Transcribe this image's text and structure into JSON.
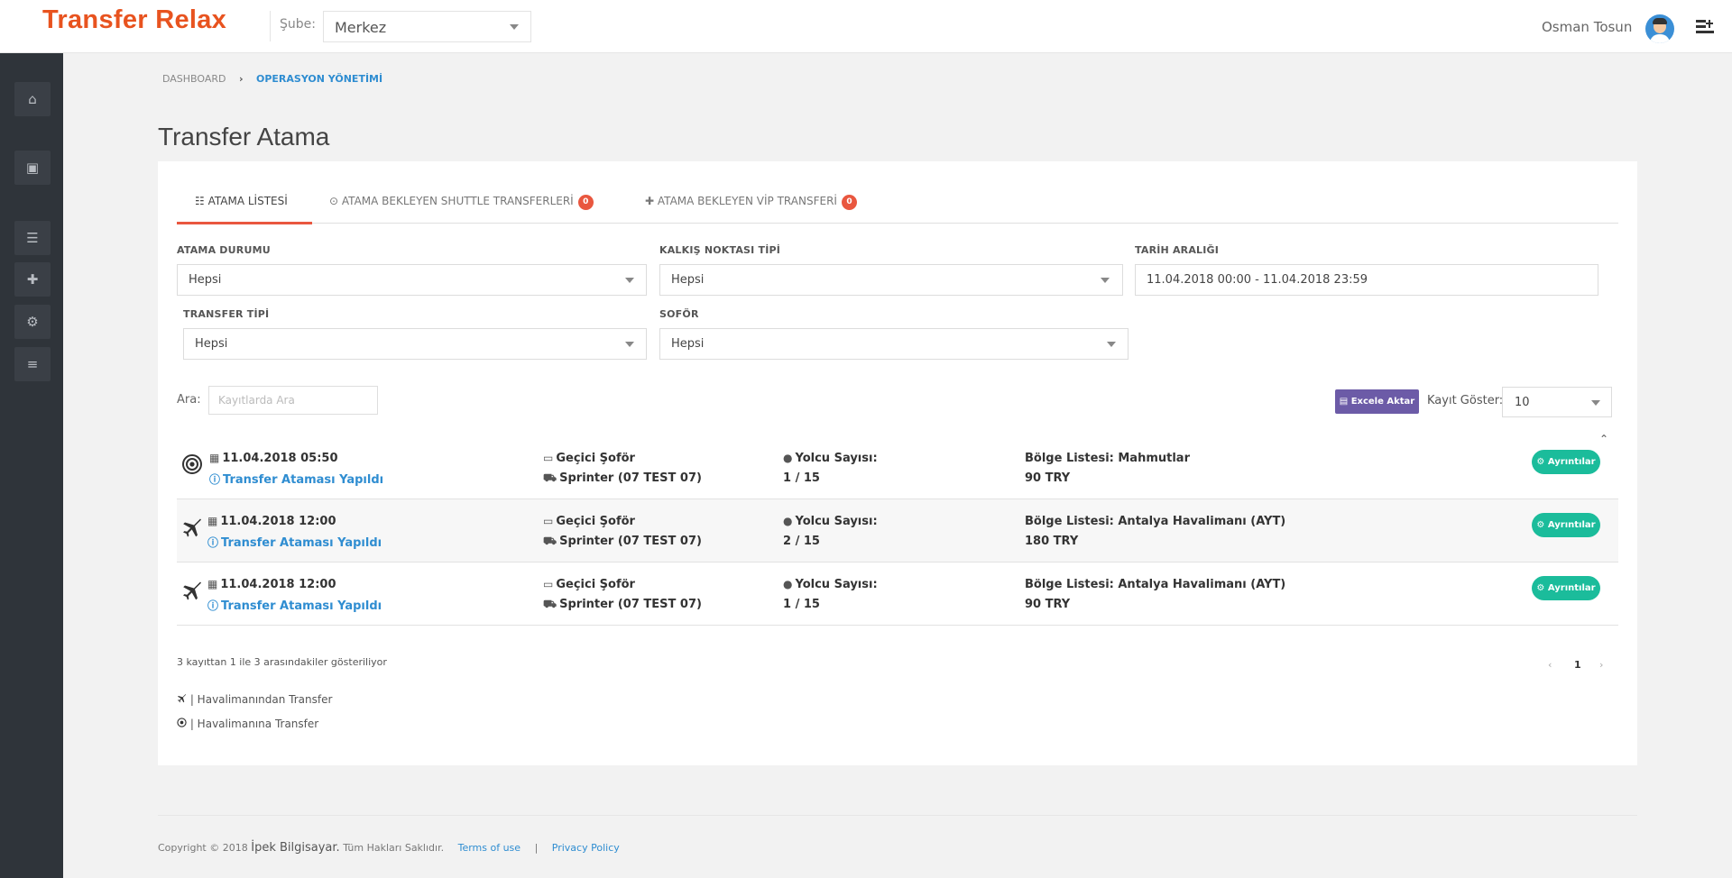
{
  "header": {
    "logo": "Transfer Relax",
    "branch_label": "Şube:",
    "branch_value": "Merkez",
    "user_name": "Osman Tosun"
  },
  "sidebar": {
    "items": [
      {
        "icon": "home-icon",
        "glyph": "⌂"
      },
      {
        "icon": "bus-icon",
        "glyph": "▣"
      },
      {
        "icon": "list-icon",
        "glyph": "☰"
      },
      {
        "icon": "plus-icon",
        "glyph": "✚"
      },
      {
        "icon": "gear-icon",
        "glyph": "⚙"
      },
      {
        "icon": "menu-icon",
        "glyph": "≡"
      }
    ]
  },
  "breadcrumb": {
    "root": "DASHBOARD",
    "separator": "›",
    "current": "OPERASYON YÖNETİMİ"
  },
  "page": {
    "title": "Transfer Atama"
  },
  "tabs": [
    {
      "icon": "list-icon",
      "glyph": "☷",
      "label": "ATAMA LİSTESİ",
      "badge": ""
    },
    {
      "icon": "clock-icon",
      "glyph": "⊙",
      "label": "ATAMA BEKLEYEN SHUTTLE TRANSFERLERİ",
      "badge": "0"
    },
    {
      "icon": "plus-icon",
      "glyph": "✚",
      "label": "ATAMA BEKLEYEN VİP TRANSFERİ",
      "badge": "0"
    }
  ],
  "filters": {
    "atama_durumu": {
      "label": "ATAMA DURUMU",
      "value": "Hepsi"
    },
    "kalkis_noktasi": {
      "label": "KALKIŞ NOKTASI TİPİ",
      "value": "Hepsi"
    },
    "tarih_araligi": {
      "label": "TARİH ARALIĞI",
      "value": "11.04.2018 00:00 - 11.04.2018 23:59"
    },
    "transfer_tipi": {
      "label": "TRANSFER TİPİ",
      "value": "Hepsi"
    },
    "sofor": {
      "label": "SOFÖR",
      "value": "Hepsi"
    }
  },
  "toolbar": {
    "search_label": "Ara:",
    "search_placeholder": "Kayıtlarda Ara",
    "excel_label": "Excele Aktar",
    "show_label": "Kayıt Göster:",
    "show_value": "10"
  },
  "rows": [
    {
      "type": "to-airport",
      "datetime": "11.04.2018 05:50",
      "status": "Transfer Ataması Yapıldı",
      "driver": "Geçici Şoför",
      "vehicle": "Sprinter (07 TEST 07)",
      "pax_label": "Yolcu Sayısı:",
      "pax": "1 / 15",
      "region": "Bölge Listesi: Mahmutlar",
      "price": "90 TRY",
      "detail": "Ayrıntılar"
    },
    {
      "type": "from-airport",
      "datetime": "11.04.2018 12:00",
      "status": "Transfer Ataması Yapıldı",
      "driver": "Geçici Şoför",
      "vehicle": "Sprinter (07 TEST 07)",
      "pax_label": "Yolcu Sayısı:",
      "pax": "2 / 15",
      "region": "Bölge Listesi: Antalya Havalimanı (AYT)",
      "price": "180 TRY",
      "detail": "Ayrıntılar"
    },
    {
      "type": "from-airport",
      "datetime": "11.04.2018 12:00",
      "status": "Transfer Ataması Yapıldı",
      "driver": "Geçici Şoför",
      "vehicle": "Sprinter (07 TEST 07)",
      "pax_label": "Yolcu Sayısı:",
      "pax": "1 / 15",
      "region": "Bölge Listesi: Antalya Havalimanı (AYT)",
      "price": "90 TRY",
      "detail": "Ayrıntılar"
    }
  ],
  "table_footer": {
    "summary": "3 kayıttan 1 ile 3 arasındakiler gösteriliyor",
    "prev": "‹",
    "page": "1",
    "next": "›"
  },
  "legend": {
    "from_airport": "| Havalimanından Transfer",
    "to_airport": "| Havalimanına Transfer"
  },
  "footer": {
    "copyright": "Copyright © 2018",
    "brand": "İpek Bilgisayar.",
    "rights": "Tüm Hakları Saklıdır.",
    "terms": "Terms of use",
    "divider": "|",
    "privacy": "Privacy Policy"
  },
  "colors": {
    "accent_orange": "#e9573f",
    "link_blue": "#2f8dd1",
    "excel_purple": "#6c5ba7",
    "detail_teal": "#1bbc9b",
    "sidebar_dark": "#2f343a"
  }
}
